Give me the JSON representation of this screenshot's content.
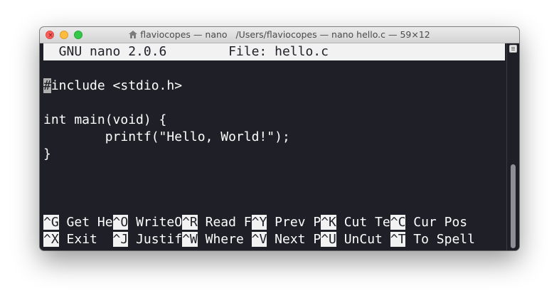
{
  "window": {
    "title_left": "flaviocopes — nano",
    "title_right": "/Users/flaviocopes — nano hello.c — 59×12",
    "close_glyph": "×"
  },
  "nano": {
    "header": "  GNU nano 2.0.6        File: hello.c",
    "lines": [
      "",
      "include <stdio.h>",
      "",
      "int main(void) {",
      "        printf(\"Hello, World!\");",
      "}"
    ],
    "cursor_char": "#",
    "shortcuts_row1": [
      {
        "key": "^G",
        "label": " Get He"
      },
      {
        "key": "^O",
        "label": " WriteO"
      },
      {
        "key": "^R",
        "label": " Read F"
      },
      {
        "key": "^Y",
        "label": " Prev P"
      },
      {
        "key": "^K",
        "label": " Cut Te"
      },
      {
        "key": "^C",
        "label": " Cur Pos"
      }
    ],
    "shortcuts_row2": [
      {
        "key": "^X",
        "label": " Exit  "
      },
      {
        "key": "^J",
        "label": " Justif"
      },
      {
        "key": "^W",
        "label": " Where "
      },
      {
        "key": "^V",
        "label": " Next P"
      },
      {
        "key": "^U",
        "label": " UnCut "
      },
      {
        "key": "^T",
        "label": " To Spell"
      }
    ]
  },
  "colors": {
    "terminal_bg": "#1f1f28",
    "header_bg": "#f2f2f2",
    "close": "#fc605c",
    "minimize": "#fdbc40",
    "maximize": "#34c84a"
  },
  "icons": {
    "title": "home-icon",
    "scroll": "scroll-menu-icon"
  }
}
